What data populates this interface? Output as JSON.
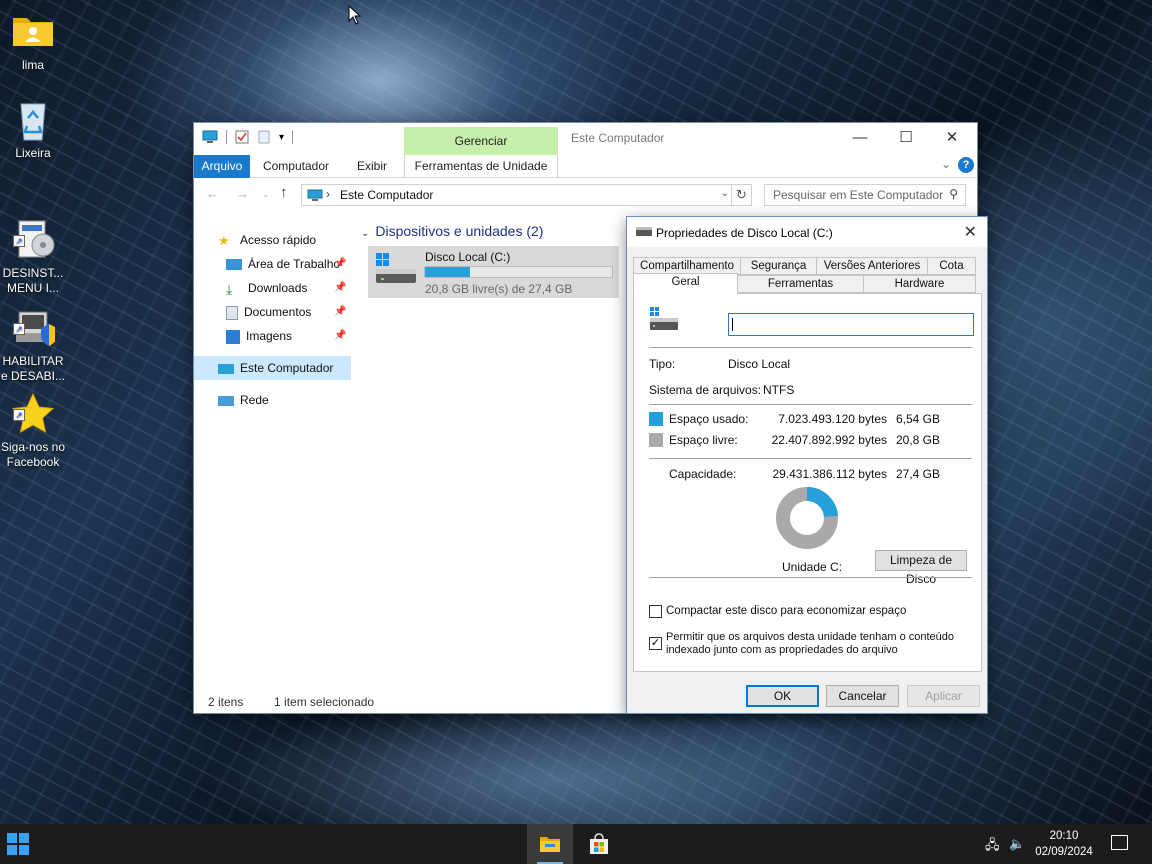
{
  "desktop": {
    "icons": [
      {
        "label": "lima",
        "icon": "user-folder-icon"
      },
      {
        "label": "Lixeira",
        "icon": "recycle-bin-icon"
      },
      {
        "label": "DESINST...\nMENU I...",
        "icon": "uninstall-menu-icon"
      },
      {
        "label": "HABILITAR\ne DESABI...",
        "icon": "enable-disable-icon"
      },
      {
        "label": "Siga-nos no\nFacebook",
        "icon": "star-icon"
      }
    ]
  },
  "explorer": {
    "manage_tab": "Gerenciar",
    "title": "Este Computador",
    "tabs": {
      "file": "Arquivo",
      "computer": "Computador",
      "view": "Exibir",
      "drive_tools": "Ferramentas de Unidade"
    },
    "help": "?",
    "address": "Este Computador",
    "search_placeholder": "Pesquisar em Este Computador",
    "nav": {
      "quick_access": "Acesso rápido",
      "desktop": "Área de Trabalho",
      "downloads": "Downloads",
      "documents": "Documentos",
      "images": "Imagens",
      "this_pc": "Este Computador",
      "network": "Rede"
    },
    "group_header": "Dispositivos e unidades (2)",
    "drive": {
      "name": "Disco Local (C:)",
      "free_text": "20,8 GB livre(s) de 27,4 GB",
      "used_fraction": 0.24
    },
    "status": {
      "count": "2 itens",
      "selected": "1 item selecionado"
    }
  },
  "dialog": {
    "title": "Propriedades de Disco Local (C:)",
    "tabs_row1": [
      "Compartilhamento",
      "Segurança",
      "Versões Anteriores",
      "Cota"
    ],
    "tabs_row2": [
      "Geral",
      "Ferramentas",
      "Hardware"
    ],
    "type_label": "Tipo:",
    "type_value": "Disco Local",
    "fs_label": "Sistema de arquivos:",
    "fs_value": "NTFS",
    "used_label": "Espaço usado:",
    "used_bytes": "7.023.493.120 bytes",
    "used_gb": "6,54 GB",
    "free_label": "Espaço livre:",
    "free_bytes": "22.407.892.992 bytes",
    "free_gb": "20,8 GB",
    "capacity_label": "Capacidade:",
    "capacity_bytes": "29.431.386.112 bytes",
    "capacity_gb": "27,4 GB",
    "used_fraction": 0.2386,
    "drive_label": "Unidade C:",
    "cleanup_button": "Limpeza de Disco",
    "compress_label": "Compactar este disco para economizar espaço",
    "compress_checked": false,
    "index_label_line1": "Permitir que os arquivos desta unidade tenham o conteúdo",
    "index_label_line2": "indexado junto com as propriedades do arquivo",
    "index_checked": true,
    "ok": "OK",
    "cancel": "Cancelar",
    "apply": "Aplicar",
    "colors": {
      "used": "#26a0da",
      "free": "#a9a9a9"
    }
  },
  "taskbar": {
    "time": "20:10",
    "date": "02/09/2024"
  }
}
